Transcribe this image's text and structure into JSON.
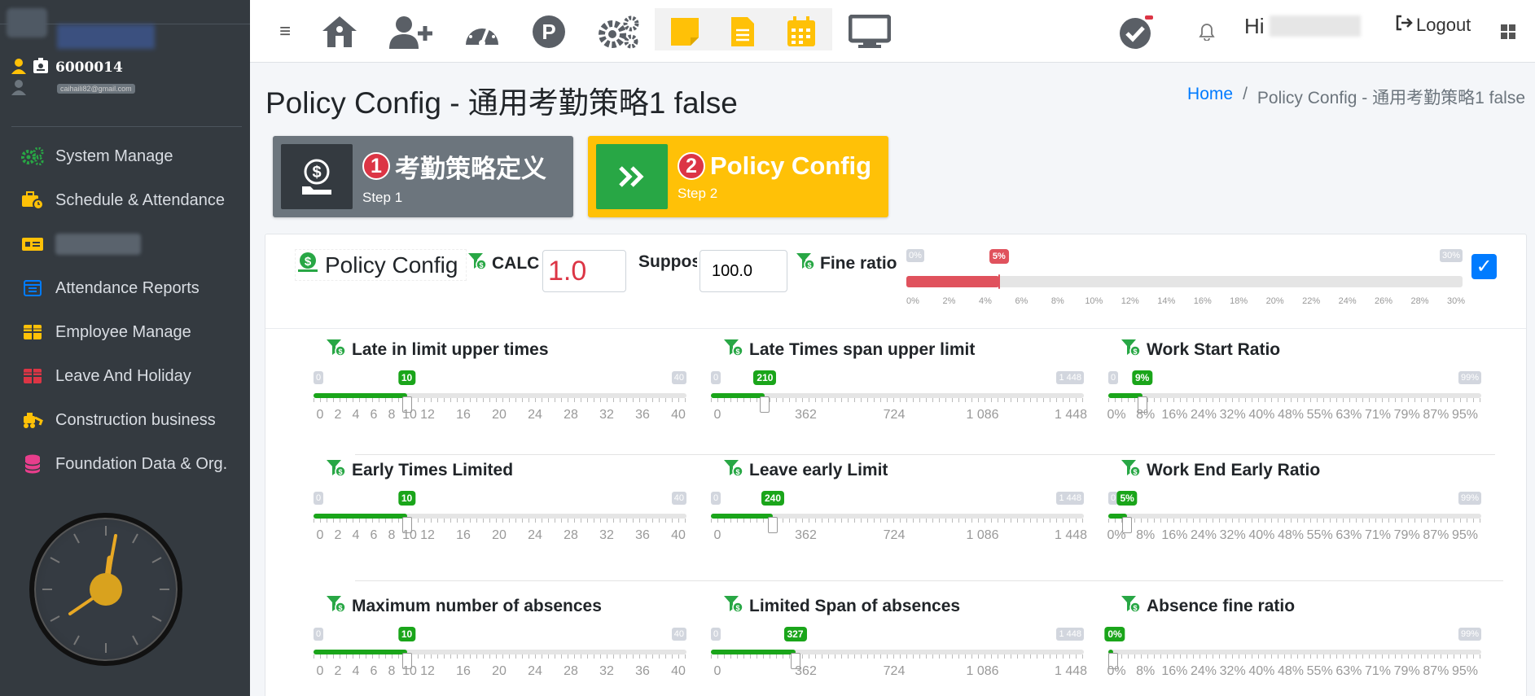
{
  "user": {
    "id": "6000014",
    "email": "caihaili82@gmail.com"
  },
  "sidebar": {
    "items": [
      {
        "label": "System Manage",
        "icon": "cogs-icon",
        "color": "#28a745"
      },
      {
        "label": "Schedule & Attendance",
        "icon": "briefcase-clock-icon",
        "color": "#ffc107"
      },
      {
        "label": "",
        "icon": "id-card-icon",
        "color": "#ffc107"
      },
      {
        "label": "Attendance Reports",
        "icon": "calendar-report-icon",
        "color": "#007bff"
      },
      {
        "label": "Employee Manage",
        "icon": "table-icon",
        "color": "#ffc107"
      },
      {
        "label": "Leave And Holiday",
        "icon": "table-icon",
        "color": "#dc3545"
      },
      {
        "label": "Construction business",
        "icon": "excavator-icon",
        "color": "#ffc107"
      },
      {
        "label": "Foundation Data & Org.",
        "icon": "database-icon",
        "color": "#e83e8c"
      }
    ]
  },
  "topbar": {
    "greeting": "Hi",
    "logout": "Logout"
  },
  "page": {
    "title": "Policy Config - 通用考勤策略1 false",
    "breadcrumb_home": "Home",
    "breadcrumb_sep": "/",
    "breadcrumb_current": "Policy Config - 通用考勤策略1 false"
  },
  "steps": [
    {
      "num": "1",
      "title": "考勤策略定义",
      "sub": "Step 1"
    },
    {
      "num": "2",
      "title": "Policy Config",
      "sub": "Step 2"
    }
  ],
  "config": {
    "title": "Policy Config",
    "calc_label": "CALC",
    "calc_value": "1.0",
    "suppo_label": "Suppos",
    "suppo_value": "100.0",
    "fine_label": "Fine ratio",
    "fine_min": "0%",
    "fine_max": "30%",
    "fine_value": "5%",
    "fine_fraction": 0.1667,
    "fine_ticks": [
      "0%",
      "2%",
      "4%",
      "6%",
      "8%",
      "10%",
      "12%",
      "14%",
      "16%",
      "18%",
      "20%",
      "22%",
      "24%",
      "26%",
      "28%",
      "30%"
    ],
    "checked": true
  },
  "sliders": [
    {
      "label": "Late in limit upper times",
      "min": "0",
      "max": "40",
      "value": "10",
      "fraction": 0.25,
      "ticks": [
        "0",
        "2",
        "4",
        "6",
        "8",
        "10",
        "12",
        "16",
        "20",
        "24",
        "28",
        "32",
        "36",
        "40"
      ],
      "kind": "count"
    },
    {
      "label": "Late Times span upper limit",
      "min": "0",
      "max": "1 448",
      "value": "210",
      "fraction": 0.145,
      "ticks": [
        "0",
        "362",
        "724",
        "1 086",
        "1 448"
      ],
      "kind": "span"
    },
    {
      "label": "Work Start Ratio",
      "min": "0",
      "max": "99%",
      "value": "9%",
      "fraction": 0.0909,
      "ticks": [
        "0%",
        "8%",
        "16%",
        "24%",
        "32%",
        "40%",
        "48%",
        "55%",
        "63%",
        "71%",
        "79%",
        "87%",
        "95%"
      ],
      "kind": "ratio"
    },
    {
      "label": "Early Times Limited",
      "min": "0",
      "max": "40",
      "value": "10",
      "fraction": 0.25,
      "ticks": [
        "0",
        "2",
        "4",
        "6",
        "8",
        "10",
        "12",
        "16",
        "20",
        "24",
        "28",
        "32",
        "36",
        "40"
      ],
      "kind": "count"
    },
    {
      "label": "Leave early Limit",
      "min": "0",
      "max": "1 448",
      "value": "240",
      "fraction": 0.166,
      "ticks": [
        "0",
        "362",
        "724",
        "1 086",
        "1 448"
      ],
      "kind": "span"
    },
    {
      "label": "Work End Early Ratio",
      "min": "0",
      "max": "99%",
      "value": "5%",
      "fraction": 0.0505,
      "ticks": [
        "0%",
        "8%",
        "16%",
        "24%",
        "32%",
        "40%",
        "48%",
        "55%",
        "63%",
        "71%",
        "79%",
        "87%",
        "95%"
      ],
      "kind": "ratio"
    },
    {
      "label": "Maximum number of absences",
      "min": "0",
      "max": "40",
      "value": "10",
      "fraction": 0.25,
      "ticks": [
        "0",
        "2",
        "4",
        "6",
        "8",
        "10",
        "12",
        "16",
        "20",
        "24",
        "28",
        "32",
        "36",
        "40"
      ],
      "kind": "count"
    },
    {
      "label": "Limited Span of absences",
      "min": "0",
      "max": "1 448",
      "value": "327",
      "fraction": 0.226,
      "ticks": [
        "0",
        "362",
        "724",
        "1 086",
        "1 448"
      ],
      "kind": "span"
    },
    {
      "label": "Absence fine ratio",
      "min": "0",
      "max": "99%",
      "value": "0%",
      "fraction": 0.0,
      "ticks": [
        "0%",
        "8%",
        "16%",
        "24%",
        "32%",
        "40%",
        "48%",
        "55%",
        "63%",
        "71%",
        "79%",
        "87%",
        "95%"
      ],
      "kind": "ratio"
    }
  ],
  "colors": {
    "green": "#1aa51a",
    "red": "#e0525d",
    "yellow": "#ffc107",
    "sidebar": "#343a40"
  }
}
